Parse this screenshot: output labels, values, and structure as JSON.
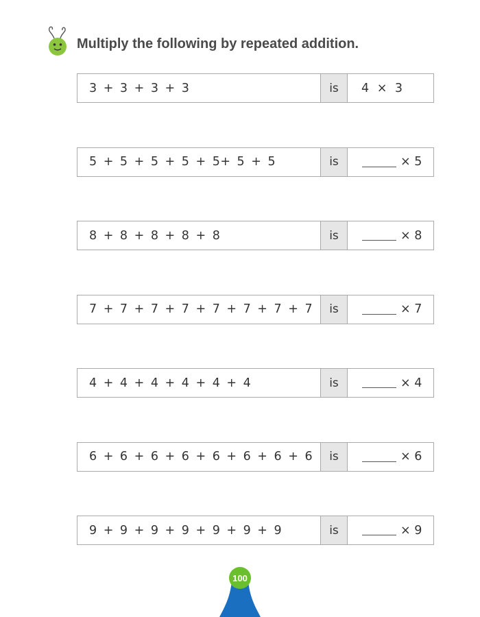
{
  "instruction": "Multiply the following by repeated addition.",
  "connector": "is",
  "rows": [
    {
      "expression": "3 + 3 + 3 + 3",
      "answer": "4 × 3",
      "is_example": true
    },
    {
      "expression": "5 + 5 + 5 + 5 + 5+ 5 + 5",
      "multiplier_label": "× 5"
    },
    {
      "expression": "8 + 8 + 8 + 8 + 8",
      "multiplier_label": "× 8"
    },
    {
      "expression": "7 + 7 + 7 + 7 + 7 + 7 + 7 + 7",
      "multiplier_label": "× 7"
    },
    {
      "expression": "4 + 4 + 4 + 4 + 4 + 4",
      "multiplier_label": "× 4"
    },
    {
      "expression": "6 + 6 + 6 + 6 + 6 + 6 + 6 + 6",
      "multiplier_label": "× 6"
    },
    {
      "expression": "9 + 9 + 9 + 9 + 9 + 9 + 9",
      "multiplier_label": "× 9"
    }
  ],
  "page_number": "100",
  "colors": {
    "mascot_green": "#8cc63f",
    "page_badge_blue": "#1b6fc0",
    "page_badge_green": "#6abf2e",
    "is_cell_bg": "#e6e6e6",
    "border": "#a9a9a9"
  },
  "icons": {
    "mascot": "green-bug-icon"
  }
}
